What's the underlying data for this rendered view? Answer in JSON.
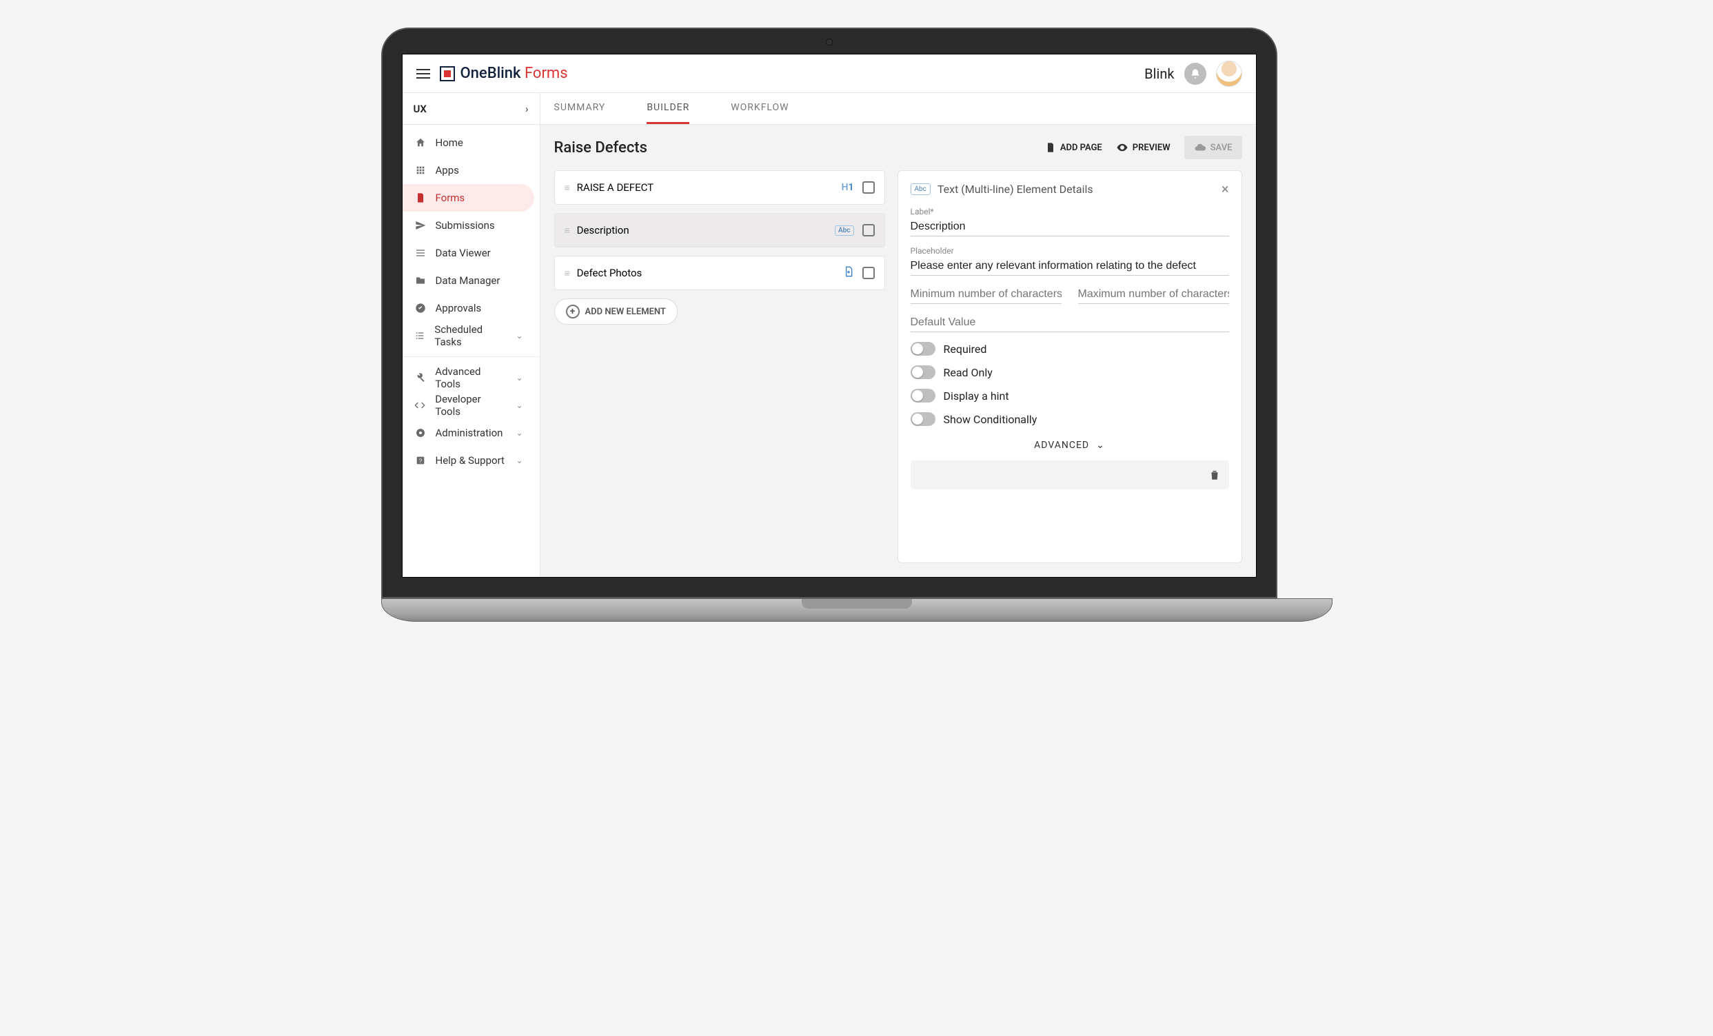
{
  "brand": {
    "name": "OneBlink",
    "product": "Forms"
  },
  "header": {
    "user": "Blink"
  },
  "sidebar": {
    "section": "UX",
    "items": [
      {
        "icon": "home-icon",
        "label": "Home",
        "expandable": false
      },
      {
        "icon": "apps-icon",
        "label": "Apps",
        "expandable": false
      },
      {
        "icon": "forms-icon",
        "label": "Forms",
        "expandable": false,
        "active": true
      },
      {
        "icon": "send-icon",
        "label": "Submissions",
        "expandable": false
      },
      {
        "icon": "list-icon",
        "label": "Data Viewer",
        "expandable": false
      },
      {
        "icon": "folder-icon",
        "label": "Data Manager",
        "expandable": false
      },
      {
        "icon": "check-icon",
        "label": "Approvals",
        "expandable": false
      },
      {
        "icon": "tasks-icon",
        "label": "Scheduled Tasks",
        "expandable": true
      }
    ],
    "items2": [
      {
        "icon": "tools-icon",
        "label": "Advanced Tools",
        "expandable": true
      },
      {
        "icon": "code-icon",
        "label": "Developer Tools",
        "expandable": true
      },
      {
        "icon": "admin-icon",
        "label": "Administration",
        "expandable": true
      },
      {
        "icon": "help-icon",
        "label": "Help & Support",
        "expandable": true
      }
    ]
  },
  "tabs": [
    {
      "label": "SUMMARY",
      "active": false
    },
    {
      "label": "BUILDER",
      "active": true
    },
    {
      "label": "WORKFLOW",
      "active": false
    }
  ],
  "page": {
    "title": "Raise Defects",
    "actions": {
      "add_page": "ADD PAGE",
      "preview": "PREVIEW",
      "save": "SAVE"
    }
  },
  "elements": [
    {
      "label": "RAISE A DEFECT",
      "type": "H1",
      "selected": false
    },
    {
      "label": "Description",
      "type": "text",
      "selected": true
    },
    {
      "label": "Defect Photos",
      "type": "file",
      "selected": false
    }
  ],
  "add_element": "ADD NEW ELEMENT",
  "details": {
    "title": "Text (Multi-line) Element Details",
    "label_caption": "Label*",
    "label_value": "Description",
    "placeholder_caption": "Placeholder",
    "placeholder_value": "Please enter any relevant information relating to the defect",
    "min_placeholder": "Minimum number of characters",
    "max_placeholder": "Maximum number of characters",
    "default_placeholder": "Default Value",
    "toggles": {
      "required": "Required",
      "readonly": "Read Only",
      "hint": "Display a hint",
      "conditional": "Show Conditionally"
    },
    "advanced": "ADVANCED"
  }
}
